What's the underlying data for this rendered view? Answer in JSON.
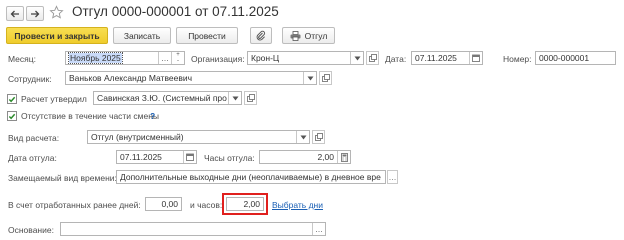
{
  "title": "Отгул 0000-000001 от 07.11.2025",
  "nav": {
    "back_icon": "arrow-left-icon",
    "forward_icon": "arrow-right-icon",
    "favorite_icon": "star-icon"
  },
  "toolbar": {
    "post_close_label": "Провести и закрыть",
    "save_label": "Записать",
    "post_label": "Провести",
    "attach_icon": "paperclip-icon",
    "print_label": "Отгул",
    "print_icon": "printer-icon"
  },
  "form": {
    "month": {
      "label": "Месяц:",
      "value": "Ноябрь 2025"
    },
    "organization": {
      "label": "Организация:",
      "value": "Крон-Ц"
    },
    "date": {
      "label": "Дата:",
      "value": "07.11.2025"
    },
    "number": {
      "label": "Номер:",
      "value": "0000-000001"
    },
    "employee": {
      "label": "Сотрудник:",
      "value": "Ваньков Александр Матвеевич"
    },
    "approved": {
      "label": "Расчет утвердил",
      "checked": true,
      "value": "Савинская З.Ю. (Системный про"
    },
    "partial_absence": {
      "label": "Отсутствие в течение части смены",
      "checked": true,
      "help": "?"
    },
    "calc_type": {
      "label": "Вид расчета:",
      "value": "Отгул (внутрисменный)"
    },
    "leave_date": {
      "label": "Дата отгула:",
      "value": "07.11.2025"
    },
    "leave_hours": {
      "label": "Часы отгула:",
      "value": "2,00"
    },
    "replaced_time": {
      "label": "Замещаемый вид времени:",
      "value": "Дополнительные выходные дни (неоплачиваемые) в дневное вре"
    },
    "worked_days": {
      "label": "В счет отработанных ранее дней:",
      "value": "0,00"
    },
    "worked_hours": {
      "label": "и часов:",
      "value": "2,00"
    },
    "choose_days_link": "Выбрать дни",
    "basis": {
      "label": "Основание:",
      "value": ""
    }
  },
  "colors": {
    "primary_button": "#f5d63d",
    "link": "#1a5fb4",
    "highlight": "#e0201e",
    "selection": "#c9daf8"
  }
}
